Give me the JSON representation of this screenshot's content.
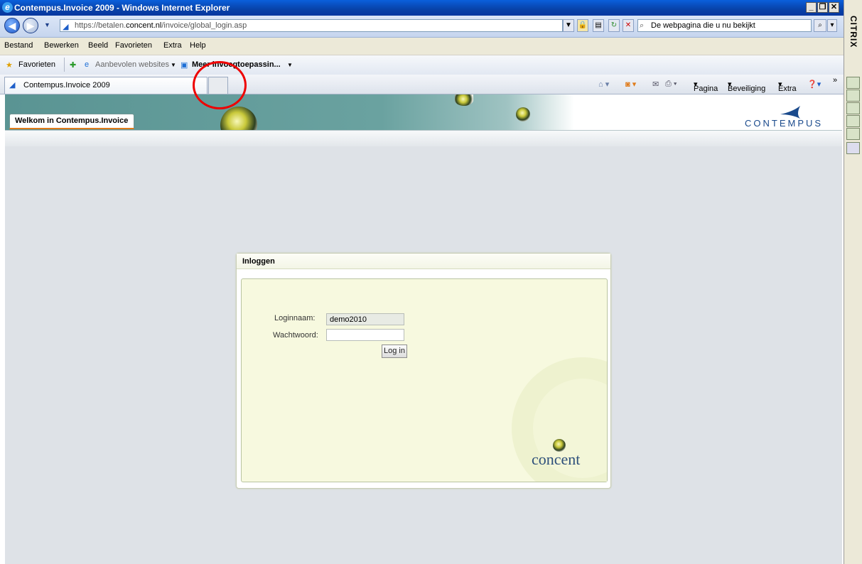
{
  "window": {
    "title": "Contempus.Invoice 2009 - Windows Internet Explorer"
  },
  "address": {
    "url_host_prefix": "https://betalen.",
    "url_host": "concent.nl",
    "url_path": "/invoice/global_login.asp",
    "search_placeholder": "De webpagina die u nu bekijkt"
  },
  "menu": {
    "items": [
      "Bestand",
      "Bewerken",
      "Beeld",
      "Favorieten",
      "Extra",
      "Help"
    ]
  },
  "favorites": {
    "favorites_label": "Favorieten",
    "recommended_label": "Aanbevolen websites",
    "more_label": "Meer invoegtoepassin..."
  },
  "tabs": {
    "active_tab": "Contempus.Invoice 2009"
  },
  "commandbar": {
    "page_label": "Pagina",
    "security_label": "Beveiliging",
    "extra_label": "Extra",
    "overflow": "»"
  },
  "banner": {
    "welcome": "Welkom in Contempus.Invoice",
    "logo_text": "CONTEMPUS"
  },
  "login": {
    "heading": "Inloggen",
    "username_label": "Loginnaam:",
    "username_value": "demo2010",
    "password_label": "Wachtwoord:",
    "password_value": "",
    "submit_label": "Log in",
    "brand": "concent"
  },
  "citrix": {
    "label": "CITRIX"
  },
  "colors": {
    "title_bar": "#0842a8",
    "banner": "#5a9493",
    "login_panel": "#f7f9df",
    "annotation": "#e00000",
    "accent_underline": "#e07b1a"
  }
}
